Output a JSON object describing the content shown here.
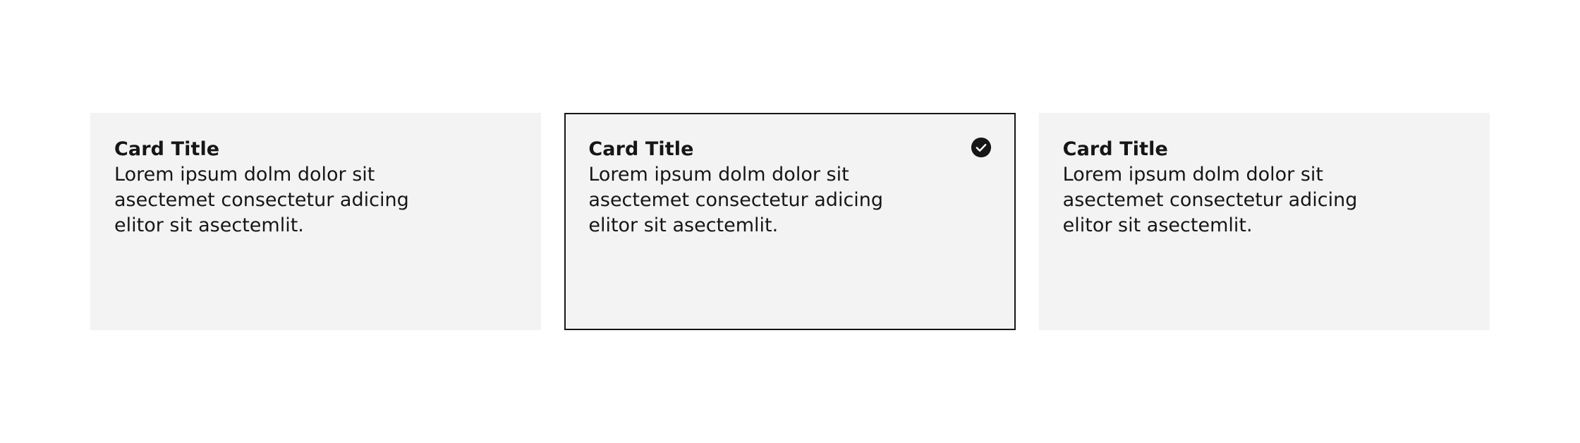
{
  "tiles": [
    {
      "title": "Card Title",
      "body": "Lorem ipsum dolm dolor sit\nasectemet consectetur adicing\nelitor sit asectemlit.",
      "selected": false
    },
    {
      "title": "Card Title",
      "body": "Lorem ipsum dolm dolor sit\nasectemet consectetur adicing\nelitor sit asectemlit.",
      "selected": true,
      "icon": "checkmark-filled-icon"
    },
    {
      "title": "Card Title",
      "body": "Lorem ipsum dolm dolor sit\nasectemet consectetur adicing\nelitor sit asectemlit.",
      "selected": false
    }
  ],
  "colors": {
    "tile_background": "#f3f3f3",
    "selected_border": "#161616",
    "text": "#161616",
    "page_background": "#ffffff"
  }
}
